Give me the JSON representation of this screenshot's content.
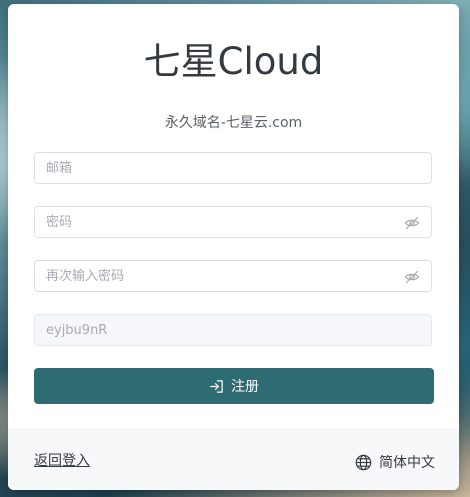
{
  "header": {
    "title": "七星Cloud",
    "subtitle": "永久域名-七星云.com"
  },
  "form": {
    "email": {
      "placeholder": "邮箱",
      "value": ""
    },
    "password": {
      "placeholder": "密码",
      "value": ""
    },
    "password_confirm": {
      "placeholder": "再次输入密码",
      "value": ""
    },
    "invite": {
      "value": "eyjbu9nR"
    },
    "submit_label": "注册"
  },
  "footer": {
    "back_login": "返回登入",
    "language": "简体中文"
  },
  "icons": {
    "eye": "eye-off-icon",
    "submit": "login-icon",
    "language": "globe-icon"
  },
  "colors": {
    "accent": "#2f6b73"
  }
}
